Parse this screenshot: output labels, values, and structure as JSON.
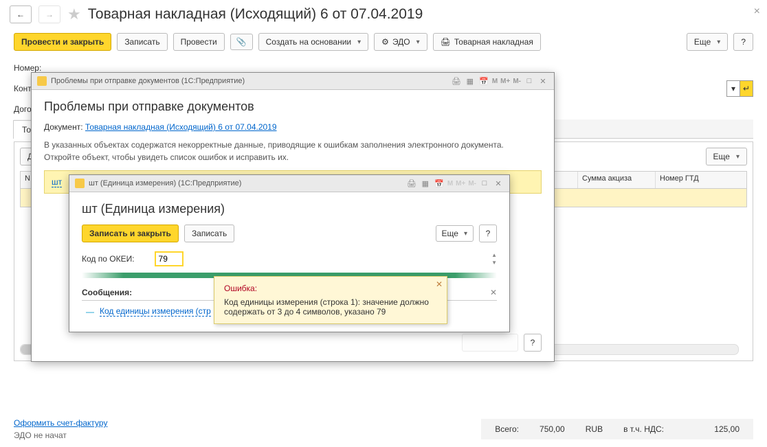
{
  "main": {
    "title": "Товарная накладная (Исходящий) 6 от 07.04.2019",
    "close_x": "×"
  },
  "toolbar": {
    "post_close": "Провести и закрыть",
    "save": "Записать",
    "post": "Провести",
    "create_basis": "Создать на основании",
    "edo": "ЭДО",
    "tn": "Товарная накладная",
    "more": "Еще",
    "help": "?"
  },
  "form": {
    "number_lbl": "Номер:",
    "contr_lbl": "Контр",
    "dogo_lbl": "Догов"
  },
  "tabs": {
    "t1": "То",
    "sub_d": "Д",
    "sub_more": "Еще",
    "col_n": "N",
    "col_sum_akciz": "Сумма акциза",
    "col_num_gtd": "Номер ГТД"
  },
  "footer": {
    "invoice": "Оформить счет-фактуру",
    "edo_status": "ЭДО не начат",
    "total_lbl": "Всего:",
    "total_val": "750,00",
    "cur": "RUB",
    "nds_lbl": "в т.ч. НДС:",
    "nds_val": "125,00"
  },
  "dialog1": {
    "winlabel": "Проблемы при отправке документов  (1С:Предприятие)",
    "m": "M",
    "mp": "M+",
    "mm": "M-",
    "head": "Проблемы при отправке документов",
    "doc_lbl": "Документ:",
    "doc_link": "Товарная накладная (Исходящий) 6 от 07.04.2019",
    "text1": "В указанных объектах содержатся некорректные данные, приводящие к ошибкам заполнения электронного документа.",
    "text2": "Откройте объект, чтобы увидеть список ошибок и исправить их.",
    "item": "шт"
  },
  "dialog2": {
    "winlabel": "шт (Единица измерения)  (1С:Предприятие)",
    "head": "шт (Единица измерения)",
    "save_close": "Записать и закрыть",
    "save": "Записать",
    "more": "Еще",
    "help": "?",
    "okei_lbl": "Код по ОКЕИ:",
    "okei_val": "79",
    "msg_head": "Сообщения:",
    "msg_text": "Код единицы измерения (стр",
    "m": "M",
    "mp": "M+",
    "mm": "M-"
  },
  "tooltip": {
    "head": "Ошибка:",
    "body": "Код единицы измерения (строка 1): значение должно содержать от 3 до 4 символов, указано 79"
  }
}
